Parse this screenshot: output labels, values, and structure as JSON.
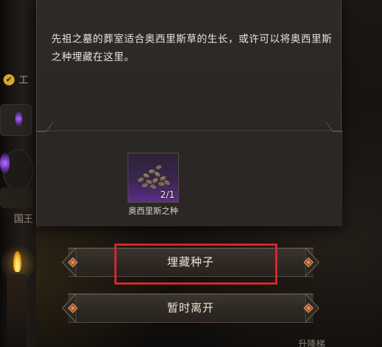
{
  "background": {
    "quest_label": "工",
    "npc_label": "国王",
    "bottom_right_label": "升降梯"
  },
  "dialog": {
    "text": "先祖之墓的葬室适合奥西里斯草的生长，或许可以将奥西里斯之种埋藏在这里。"
  },
  "item": {
    "name": "奥西里斯之种",
    "count": "2/1",
    "icon": "seed-pile-icon",
    "rarity_color": "#5a2e8a"
  },
  "actions": {
    "bury_label": "埋藏种子",
    "leave_label": "暂时离开"
  },
  "highlight_color": "#e0262b"
}
